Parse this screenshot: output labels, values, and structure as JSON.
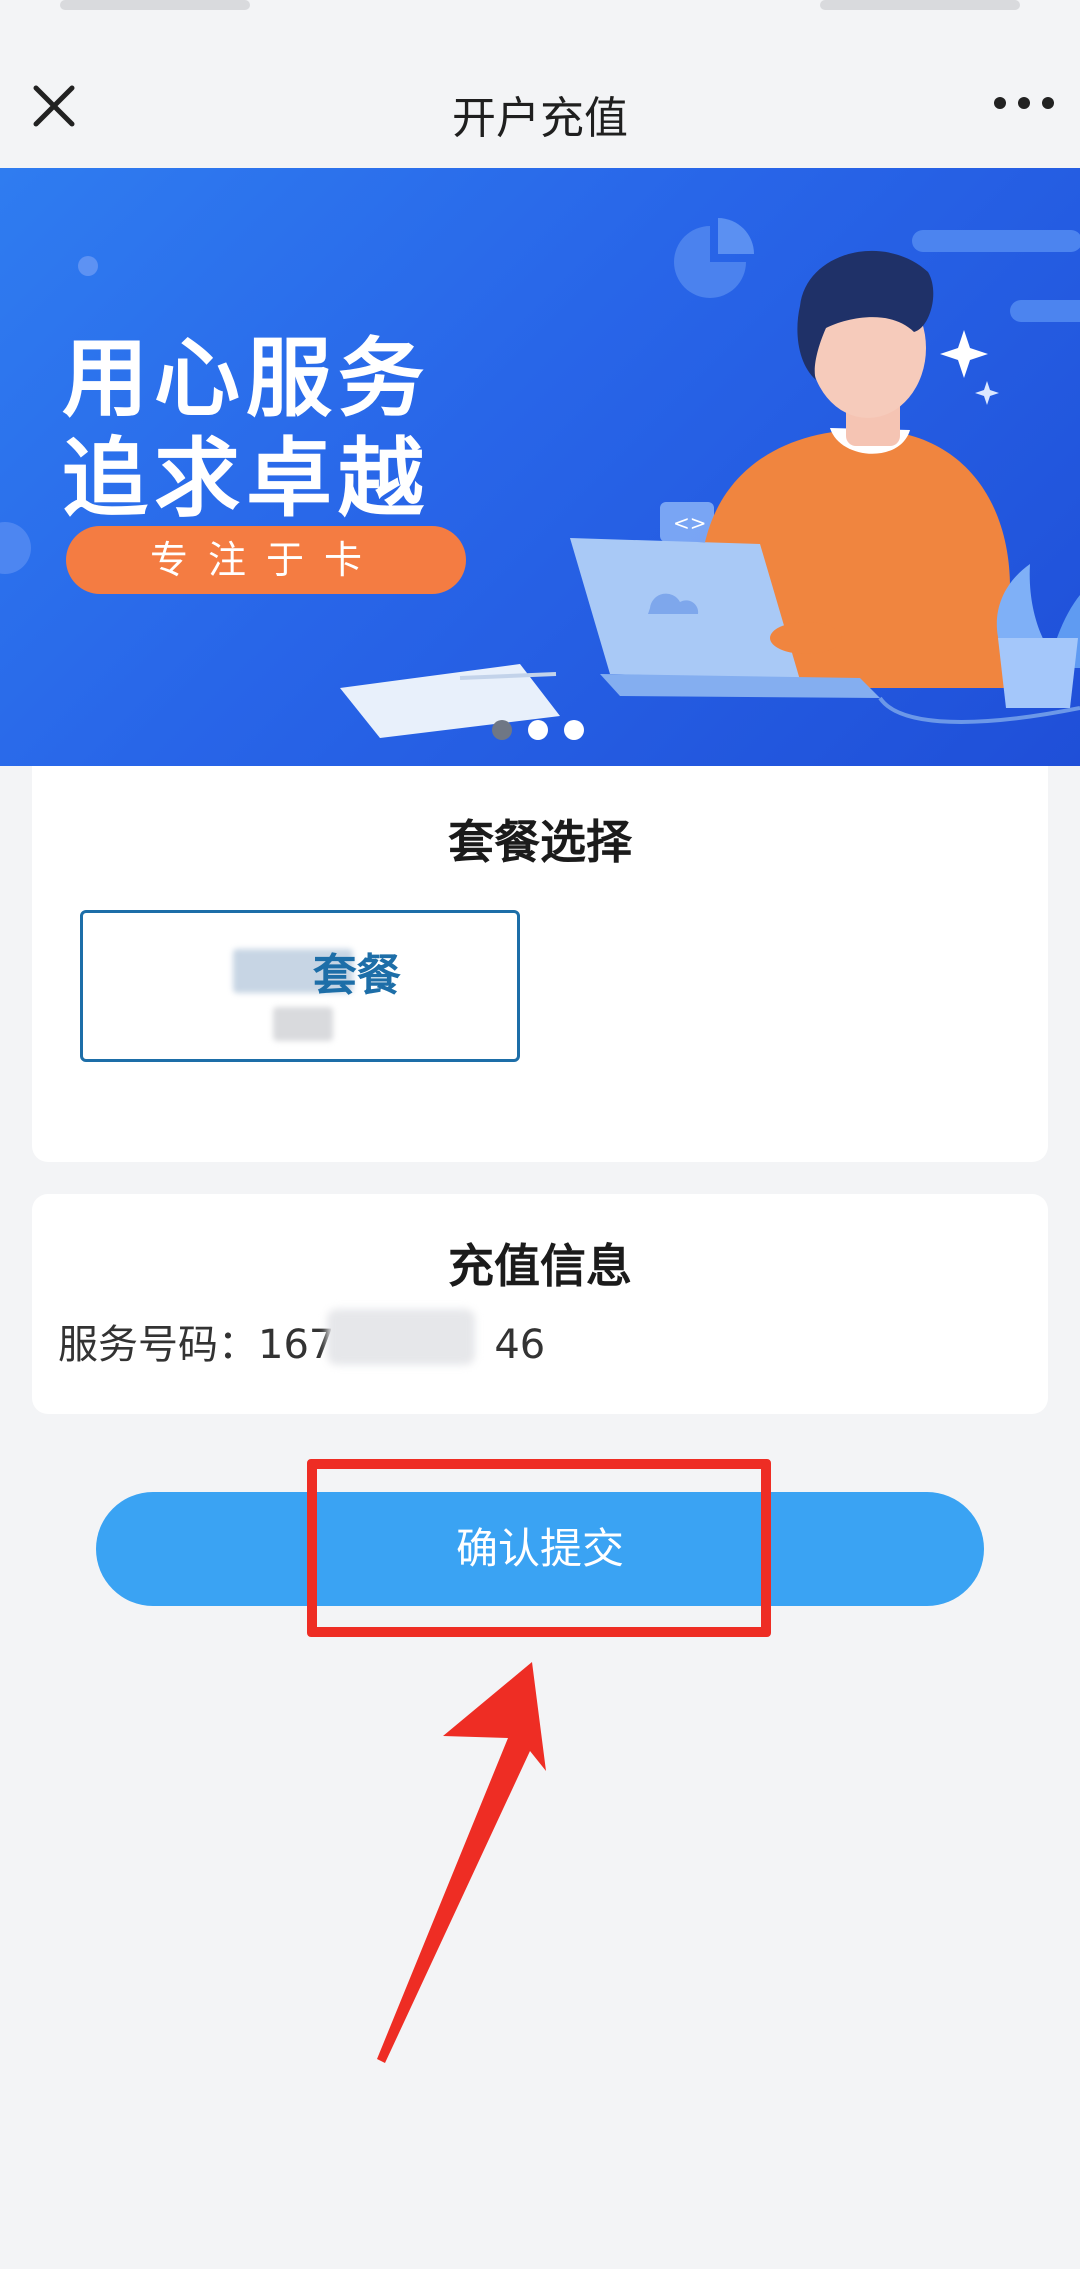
{
  "navbar": {
    "title": "开户充值",
    "close_icon": "close-icon",
    "more_icon": "more-icon"
  },
  "banner": {
    "headline_line1": "用心服务",
    "headline_line2": "追求卓越",
    "tag": "专注于卡",
    "slide_count": 3,
    "active_slide": 1
  },
  "package_section": {
    "title": "套餐选择",
    "selected_package_suffix": "套餐"
  },
  "recharge_section": {
    "title": "充值信息",
    "service_label": "服务号码：",
    "number_prefix": "167",
    "number_suffix": "46"
  },
  "submit_button": {
    "label": "确认提交"
  },
  "colors": {
    "accent": "#3aa3f3",
    "highlight_border": "#ee2d24",
    "banner": "#2865e8",
    "banner_pill": "#f47c42"
  }
}
